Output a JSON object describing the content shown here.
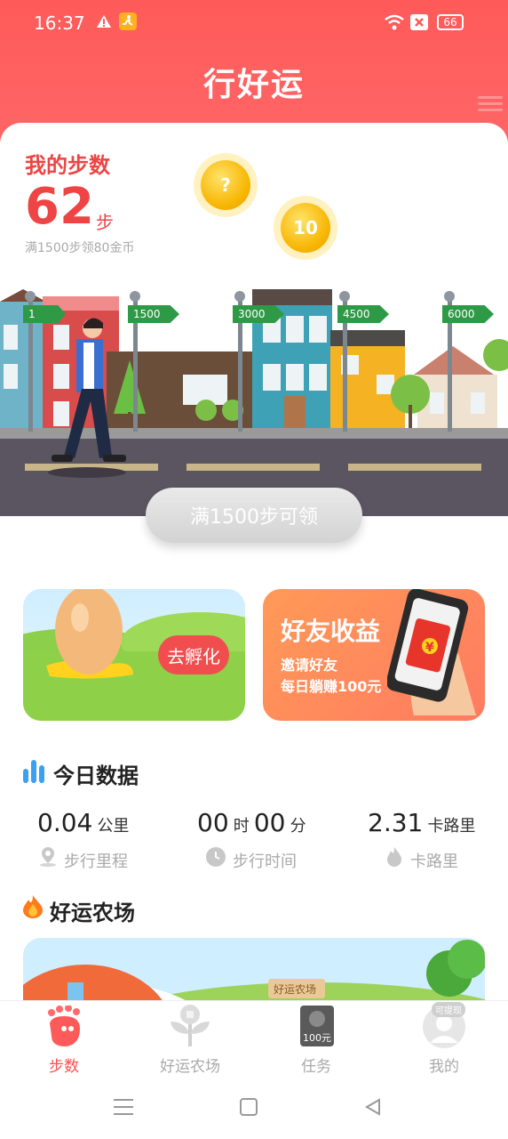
{
  "status_bar": {
    "time": "16:37",
    "battery": "66"
  },
  "header": {
    "title": "行好运"
  },
  "steps_card": {
    "title": "我的步数",
    "count": "62",
    "unit": "步",
    "hint": "满1500步领80金币",
    "coins": [
      "?",
      "10"
    ],
    "milestones": [
      "1",
      "1500",
      "3000",
      "4500",
      "6000"
    ],
    "claim_label": "满1500步可领"
  },
  "banners": {
    "hatch": {
      "button": "去孵化"
    },
    "friend": {
      "title": "好友收益",
      "line1": "邀请好友",
      "line2": "每日躺赚100元",
      "phone_symbol": "¥"
    }
  },
  "today": {
    "title": "今日数据",
    "distance": {
      "value": "0.04",
      "unit": "公里",
      "label": "步行里程"
    },
    "time": {
      "hours": "00",
      "h_unit": "时",
      "minutes": "00",
      "m_unit": "分",
      "label": "步行时间"
    },
    "calories": {
      "value": "2.31",
      "unit": "卡路里",
      "label": "卡路里"
    }
  },
  "farm": {
    "title": "好运农场",
    "sign": "好运农场"
  },
  "tabs": [
    {
      "label": "步数",
      "active": true
    },
    {
      "label": "好运农场",
      "active": false
    },
    {
      "label": "任务",
      "active": false,
      "badge": "100元"
    },
    {
      "label": "我的",
      "active": false,
      "badge": "可提现"
    }
  ],
  "colors": {
    "brand": "#ff5a5a",
    "accent": "#e44444"
  }
}
